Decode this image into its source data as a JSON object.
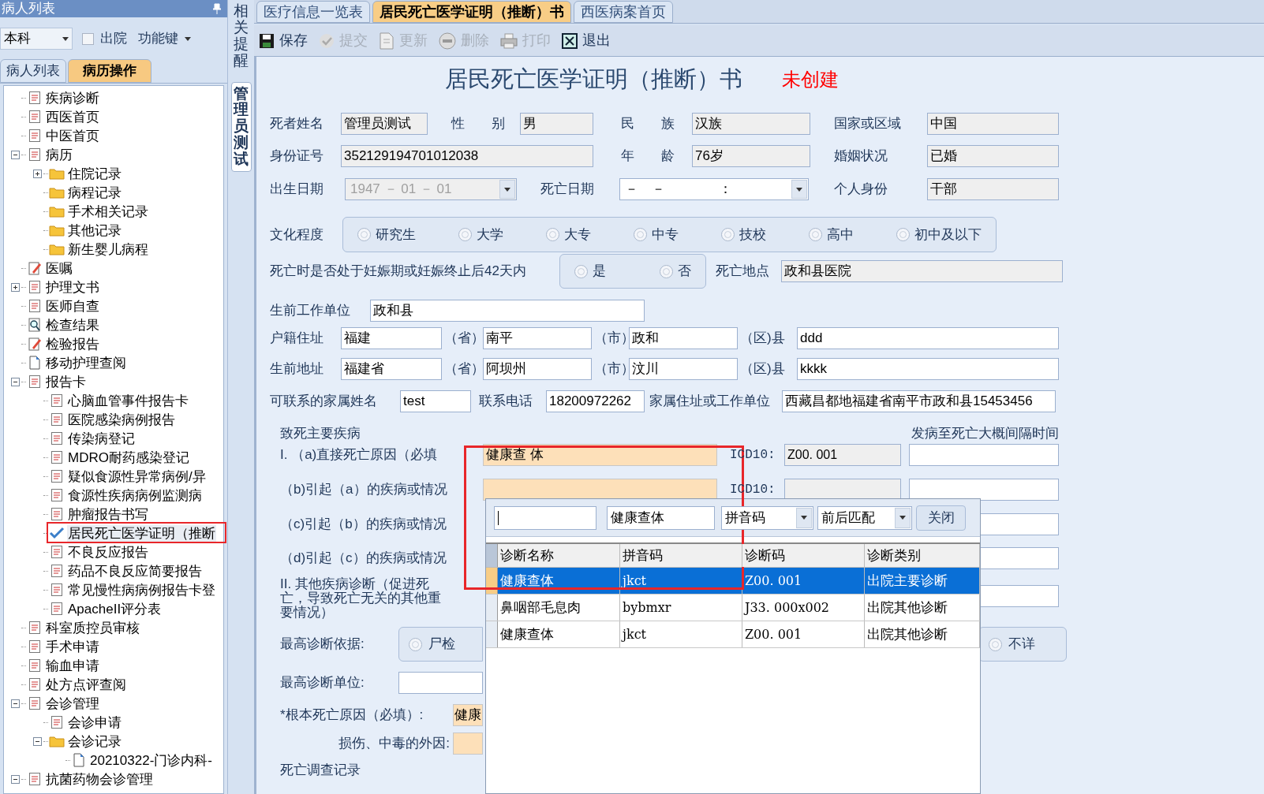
{
  "patient_panel": {
    "title": "病人列表",
    "department": "本科",
    "discharged": {
      "label": "出院",
      "checked": false
    },
    "function_menu": "功能键",
    "tabs": [
      {
        "label": "病人列表",
        "selected": false
      },
      {
        "label": "病历操作",
        "selected": true
      }
    ],
    "tree": [
      {
        "label": "疾病诊断",
        "kind": "document",
        "selected": false
      },
      {
        "label": "西医首页",
        "kind": "document",
        "selected": false
      },
      {
        "label": "中医首页",
        "kind": "document",
        "selected": false
      },
      {
        "label": "病历",
        "kind": "document",
        "selected": false,
        "expanded": true,
        "children": [
          {
            "label": "住院记录",
            "kind": "folder",
            "selected": false,
            "expanded": false
          },
          {
            "label": "病程记录",
            "kind": "folder",
            "selected": false
          },
          {
            "label": "手术相关记录",
            "kind": "folder",
            "selected": false
          },
          {
            "label": "其他记录",
            "kind": "folder",
            "selected": false
          },
          {
            "label": "新生婴儿病程",
            "kind": "folder",
            "selected": false
          }
        ]
      },
      {
        "label": "医嘱",
        "kind": "pencil",
        "selected": false
      },
      {
        "label": "护理文书",
        "kind": "document",
        "selected": false,
        "expanded": false
      },
      {
        "label": "医师自查",
        "kind": "document",
        "selected": false
      },
      {
        "label": "检查结果",
        "kind": "magnifier",
        "selected": false
      },
      {
        "label": "检验报告",
        "kind": "pencil",
        "selected": false
      },
      {
        "label": "移动护理查阅",
        "kind": "page",
        "selected": false
      },
      {
        "label": "报告卡",
        "kind": "document",
        "selected": false,
        "expanded": true,
        "children": [
          {
            "label": "心脑血管事件报告卡",
            "kind": "document",
            "selected": false
          },
          {
            "label": "医院感染病例报告",
            "kind": "document",
            "selected": false
          },
          {
            "label": "传染病登记",
            "kind": "document",
            "selected": false
          },
          {
            "label": "MDRO耐药感染登记",
            "kind": "document",
            "selected": false
          },
          {
            "label": "疑似食源性异常病例/异",
            "kind": "document",
            "selected": false
          },
          {
            "label": "食源性疾病病例监测病",
            "kind": "document",
            "selected": false
          },
          {
            "label": "肿瘤报告书写",
            "kind": "document",
            "selected": false
          },
          {
            "label": "居民死亡医学证明（推断",
            "kind": "check",
            "selected": true
          },
          {
            "label": "不良反应报告",
            "kind": "document",
            "selected": false
          },
          {
            "label": "药品不良反应简要报告",
            "kind": "document",
            "selected": false
          },
          {
            "label": "常见慢性病病例报告卡登",
            "kind": "document",
            "selected": false
          },
          {
            "label": "ApacheII评分表",
            "kind": "document",
            "selected": false
          }
        ]
      },
      {
        "label": "科室质控员审核",
        "kind": "document",
        "selected": false
      },
      {
        "label": "手术申请",
        "kind": "document",
        "selected": false
      },
      {
        "label": "输血申请",
        "kind": "document",
        "selected": false
      },
      {
        "label": "处方点评查阅",
        "kind": "document",
        "selected": false
      },
      {
        "label": "会诊管理",
        "kind": "document",
        "selected": false,
        "expanded": true,
        "children": [
          {
            "label": "会诊申请",
            "kind": "document",
            "selected": false
          },
          {
            "label": "会诊记录",
            "kind": "folder",
            "selected": false,
            "expanded": true,
            "children": [
              {
                "label": "20210322-门诊内科-",
                "kind": "page",
                "selected": false
              }
            ]
          }
        ]
      },
      {
        "label": "抗菌药物会诊管理",
        "kind": "document",
        "selected": false,
        "expanded": true
      }
    ]
  },
  "side_tabs": [
    {
      "label": "相关提醒",
      "selected": false
    },
    {
      "label": "管理员测试",
      "selected": true
    }
  ],
  "document_tabs": [
    {
      "label": "医疗信息一览表",
      "selected": false
    },
    {
      "label": "居民死亡医学证明（推断）书",
      "selected": true
    },
    {
      "label": "西医病案首页",
      "selected": false
    }
  ],
  "toolbar": [
    {
      "label": "保存",
      "kind": "save",
      "disabled": false
    },
    {
      "label": "提交",
      "kind": "check",
      "disabled": true
    },
    {
      "label": "更新",
      "kind": "document",
      "disabled": true
    },
    {
      "label": "删除",
      "kind": "minus",
      "disabled": true
    },
    {
      "label": "打印",
      "kind": "printer",
      "disabled": true
    },
    {
      "label": "退出",
      "kind": "close",
      "disabled": false
    }
  ],
  "form": {
    "title": "居民死亡医学证明（推断）书",
    "status": "未创建",
    "rows": [
      {
        "items": [
          {
            "kind": "label",
            "text": "死者姓名"
          },
          {
            "kind": "field",
            "value": "管理员测试",
            "readonly": true
          },
          {
            "kind": "label",
            "text": "性　　别"
          },
          {
            "kind": "field",
            "value": "男",
            "readonly": true
          },
          {
            "kind": "label",
            "text": "民　　族"
          },
          {
            "kind": "field",
            "value": "汉族",
            "readonly": true
          },
          {
            "kind": "label",
            "text": "国家或区域"
          },
          {
            "kind": "field",
            "value": "中国",
            "readonly": true
          }
        ]
      },
      {
        "items": [
          {
            "kind": "label",
            "text": "身份证号"
          },
          {
            "kind": "field",
            "value": "352129194701012038",
            "readonly": true
          },
          {
            "kind": "label",
            "text": "年　　龄"
          },
          {
            "kind": "field",
            "value": "76岁",
            "readonly": true
          },
          {
            "kind": "label",
            "text": "婚姻状况"
          },
          {
            "kind": "field",
            "value": "已婚",
            "readonly": true
          }
        ]
      },
      {
        "items": [
          {
            "kind": "label",
            "text": "出生日期"
          },
          {
            "kind": "combo",
            "value": "1947 － 01 － 01",
            "disabled": true
          },
          {
            "kind": "label",
            "text": "死亡日期"
          },
          {
            "kind": "combo",
            "value": "－　－　　　　：",
            "disabled": false
          },
          {
            "kind": "label",
            "text": "个人身份"
          },
          {
            "kind": "field",
            "value": "干部",
            "readonly": true
          }
        ]
      },
      {
        "items": [
          {
            "kind": "label",
            "text": "文化程度"
          },
          {
            "kind": "radios",
            "options": [
              {
                "label": "研究生",
                "selected": false
              },
              {
                "label": "大学",
                "selected": false
              },
              {
                "label": "大专",
                "selected": false
              },
              {
                "label": "中专",
                "selected": false
              },
              {
                "label": "技校",
                "selected": false
              },
              {
                "label": "高中",
                "selected": false
              },
              {
                "label": "初中及以下",
                "selected": false
              }
            ]
          }
        ]
      },
      {
        "items": [
          {
            "kind": "label",
            "text": "死亡时是否处于妊娠期或妊娠终止后42天内"
          },
          {
            "kind": "radios",
            "options": [
              {
                "label": "是",
                "selected": false
              },
              {
                "label": "否",
                "selected": false
              }
            ]
          },
          {
            "kind": "label",
            "text": "死亡地点"
          },
          {
            "kind": "field",
            "value": "政和县医院",
            "readonly": true
          }
        ]
      },
      {
        "items": [
          {
            "kind": "label",
            "text": "生前工作单位"
          },
          {
            "kind": "field",
            "value": "政和县",
            "readonly": false
          }
        ]
      },
      {
        "items": [
          {
            "kind": "label",
            "text": "户籍住址"
          },
          {
            "kind": "field",
            "value": "福建",
            "readonly": false
          },
          {
            "kind": "label",
            "text": "（省）"
          },
          {
            "kind": "field",
            "value": "南平",
            "readonly": false
          },
          {
            "kind": "label",
            "text": "（市）"
          },
          {
            "kind": "field",
            "value": "政和",
            "readonly": false
          },
          {
            "kind": "label",
            "text": "（区)县"
          },
          {
            "kind": "field",
            "value": "ddd",
            "readonly": false
          }
        ]
      },
      {
        "items": [
          {
            "kind": "label",
            "text": "生前地址"
          },
          {
            "kind": "field",
            "value": "福建省",
            "readonly": false
          },
          {
            "kind": "label",
            "text": "（省）"
          },
          {
            "kind": "field",
            "value": "阿坝州",
            "readonly": false
          },
          {
            "kind": "label",
            "text": "（市）"
          },
          {
            "kind": "field",
            "value": "汶川",
            "readonly": false
          },
          {
            "kind": "label",
            "text": "（区)县"
          },
          {
            "kind": "field",
            "value": "kkkk",
            "readonly": false
          }
        ]
      },
      {
        "items": [
          {
            "kind": "label",
            "text": "可联系的家属姓名"
          },
          {
            "kind": "field",
            "value": "test",
            "readonly": false
          },
          {
            "kind": "label",
            "text": "联系电话"
          },
          {
            "kind": "field",
            "value": "18200972262",
            "readonly": false
          },
          {
            "kind": "label",
            "text": "家属住址或工作单位"
          },
          {
            "kind": "field",
            "value": "西藏昌都地福建省南平市政和县15453456",
            "readonly": false
          }
        ]
      }
    ],
    "causes_heading": "致死主要疾病",
    "interval_heading": "发病至死亡大概间隔时间",
    "causes": [
      {
        "kind": "visible",
        "label": "I. （a)直接死亡原因（必填",
        "diagnosis": "健康查 体",
        "icd_label": "ICD10:",
        "icd": "Z00. 001"
      },
      {
        "kind": "visible",
        "label": "（b)引起（a）的疾病或情况",
        "icd_label": "ICD10:"
      },
      {
        "kind": "covered",
        "label": "（c)引起（b）的疾病或情况"
      },
      {
        "kind": "covered",
        "label": "（d)引起（c）的疾病或情况"
      }
    ],
    "other_diseases": "II. 其他疾病诊断（促进死亡，导致死亡无关的其他重要情况）",
    "basis": {
      "label": "最高诊断依据:",
      "options": [
        {
          "label": "尸检",
          "selected": false
        },
        {
          "label": "不详",
          "selected": false
        }
      ]
    },
    "unit_label": "最高诊断单位:",
    "root_cause": {
      "label": "*根本死亡原因（必填）:",
      "value": "健康"
    },
    "injury_label": "损伤、中毒的外因:",
    "survey_heading": "死亡调查记录"
  },
  "lookup_popup": {
    "search_text": "健康查体",
    "match_field": "拼音码",
    "match_mode": "前后匹配",
    "close": "关闭",
    "columns": [
      "诊断名称",
      "拼音码",
      "诊断码",
      "诊断类别"
    ],
    "rows": [
      {
        "cells": [
          "健康查体",
          "jkct",
          "Z00. 001",
          "出院主要诊断"
        ],
        "selected": true
      },
      {
        "cells": [
          "鼻咽部毛息肉",
          "bybmxr",
          "J33. 000x002",
          "出院其他诊断"
        ],
        "selected": false
      },
      {
        "cells": [
          "健康查体",
          "jkct",
          "Z00. 001",
          "出院其他诊断"
        ],
        "selected": false
      }
    ]
  }
}
